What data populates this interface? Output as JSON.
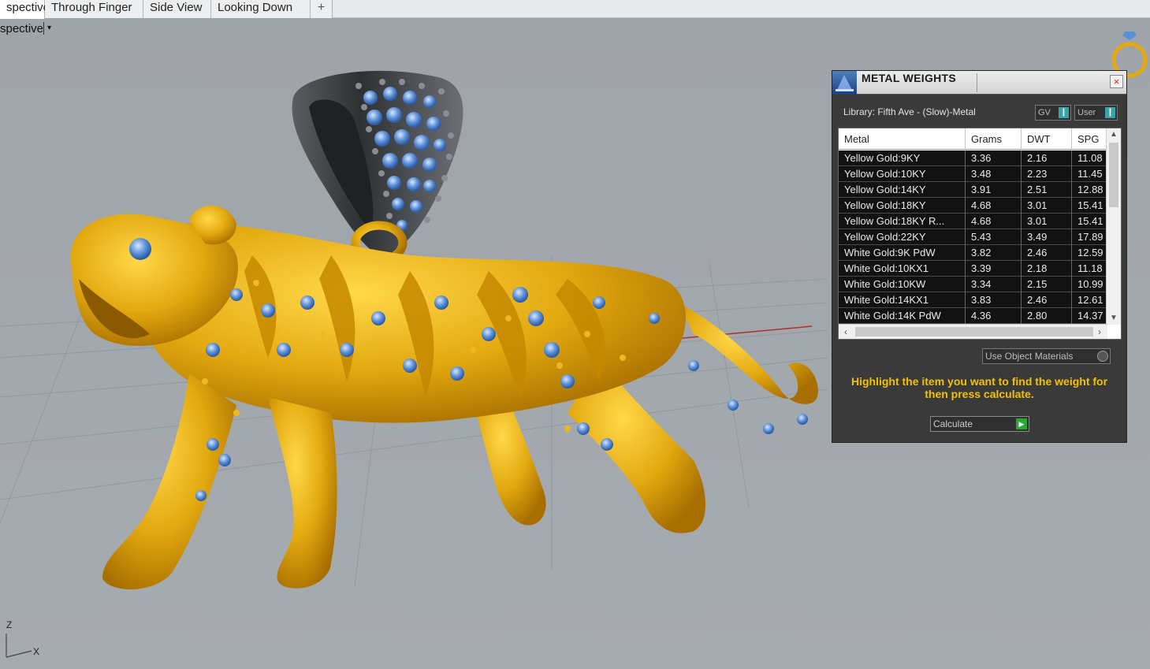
{
  "tabs": [
    {
      "label": "spective",
      "active": true
    },
    {
      "label": "Through Finger",
      "active": false
    },
    {
      "label": "Side View",
      "active": false
    },
    {
      "label": "Looking Down",
      "active": false
    }
  ],
  "tab_add_glyph": "+",
  "viewport": {
    "label": "spective",
    "dropdown_glyph": "▾",
    "axis_z": "Z",
    "axis_x": "X"
  },
  "panel": {
    "title": "METAL WEIGHTS",
    "close_glyph": "×",
    "library": "Library: Fifth Ave - (Slow)-Metal",
    "toggle_gv": "GV",
    "toggle_user": "User",
    "columns": [
      "Metal",
      "Grams",
      "DWT",
      "SPG"
    ],
    "rows": [
      {
        "metal": "Yellow Gold:9KY",
        "grams": "3.36",
        "dwt": "2.16",
        "spg": "11.08"
      },
      {
        "metal": "Yellow Gold:10KY",
        "grams": "3.48",
        "dwt": "2.23",
        "spg": "11.45"
      },
      {
        "metal": "Yellow Gold:14KY",
        "grams": "3.91",
        "dwt": "2.51",
        "spg": "12.88"
      },
      {
        "metal": "Yellow Gold:18KY",
        "grams": "4.68",
        "dwt": "3.01",
        "spg": "15.41"
      },
      {
        "metal": "Yellow Gold:18KY R...",
        "grams": "4.68",
        "dwt": "3.01",
        "spg": "15.41"
      },
      {
        "metal": "Yellow Gold:22KY",
        "grams": "5.43",
        "dwt": "3.49",
        "spg": "17.89"
      },
      {
        "metal": "White Gold:9K PdW",
        "grams": "3.82",
        "dwt": "2.46",
        "spg": "12.59"
      },
      {
        "metal": "White Gold:10KX1",
        "grams": "3.39",
        "dwt": "2.18",
        "spg": "11.18"
      },
      {
        "metal": "White Gold:10KW",
        "grams": "3.34",
        "dwt": "2.15",
        "spg": "10.99"
      },
      {
        "metal": "White Gold:14KX1",
        "grams": "3.83",
        "dwt": "2.46",
        "spg": "12.61"
      },
      {
        "metal": "White Gold:14K PdW",
        "grams": "4.36",
        "dwt": "2.80",
        "spg": "14.37"
      }
    ],
    "use_object_materials": "Use Object Materials",
    "hint": "Highlight the item you want to find the weight for then press calculate.",
    "calculate_label": "Calculate"
  },
  "colors": {
    "gold": "#e3a90f",
    "gem_blue": "#5b8fd6",
    "panel_bg": "#3a3a3a",
    "hint_yellow": "#f2c200"
  }
}
